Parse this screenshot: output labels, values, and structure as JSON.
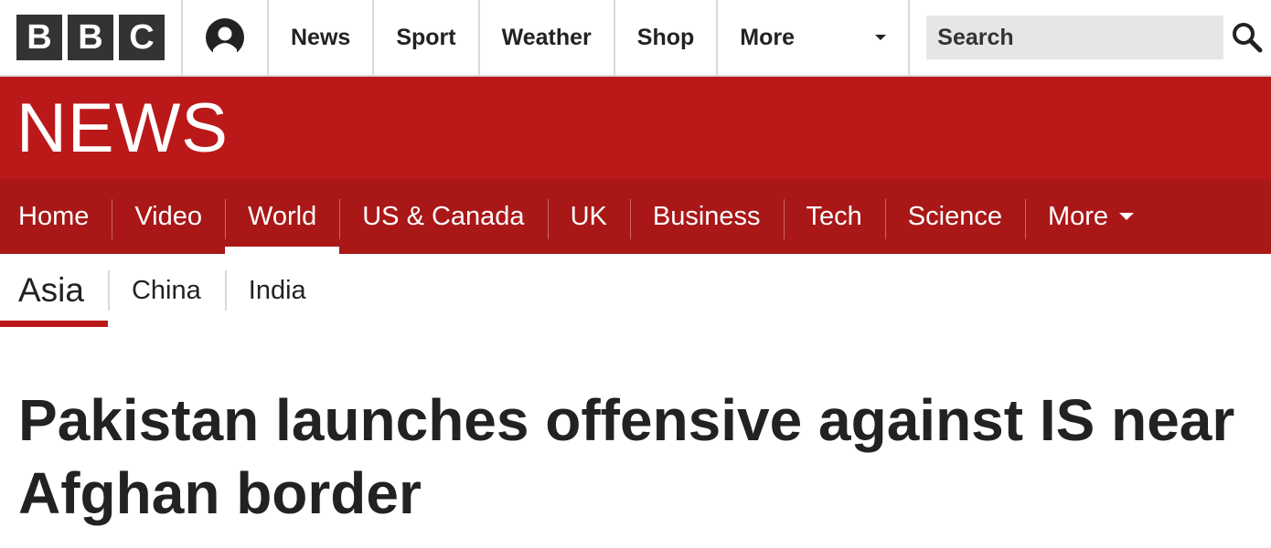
{
  "header": {
    "logo_letters": [
      "B",
      "B",
      "C"
    ],
    "account_icon": "account-icon",
    "nav": [
      "News",
      "Sport",
      "Weather",
      "Shop"
    ],
    "more_label": "More",
    "search_placeholder": "Search",
    "search_icon": "search-icon"
  },
  "masthead": {
    "title": "NEWS",
    "color": "#bb1919"
  },
  "section_nav": {
    "items": [
      "Home",
      "Video",
      "World",
      "US & Canada",
      "UK",
      "Business",
      "Tech",
      "Science"
    ],
    "active": "World",
    "more_label": "More",
    "color": "#a91717"
  },
  "sub_nav": {
    "items": [
      "Asia",
      "China",
      "India"
    ],
    "active": "Asia"
  },
  "article": {
    "headline": "Pakistan launches offensive against IS near Afghan border"
  }
}
